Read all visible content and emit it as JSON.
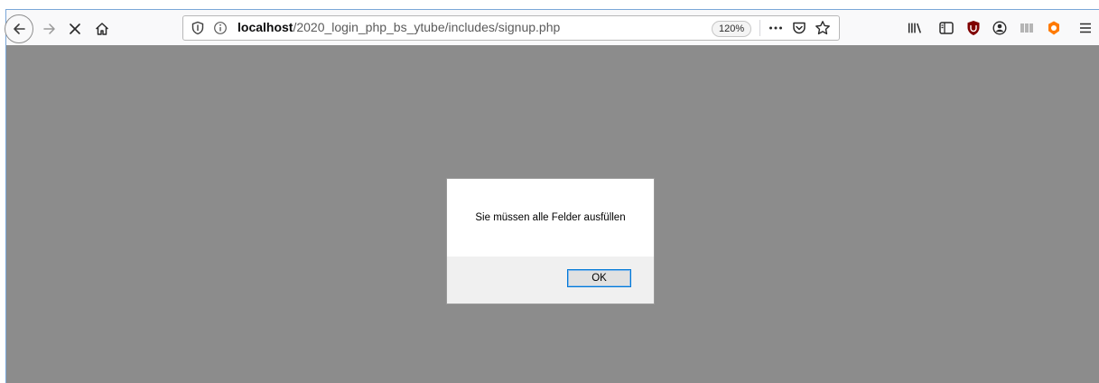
{
  "browser": {
    "url": {
      "host": "localhost",
      "path": "/2020_login_php_bs_ytube/includes/signup.php"
    },
    "zoom": "120%",
    "icons": {
      "nav": [
        "back-icon",
        "forward-icon",
        "stop-icon",
        "home-icon"
      ],
      "url": [
        "tracking-protection-shield-icon",
        "site-info-icon",
        "page-actions-menu-icon",
        "pocket-icon",
        "bookmark-star-icon"
      ],
      "toolbar": [
        "library-icon",
        "sidebar-icon",
        "ublock-origin-icon",
        "account-icon",
        "reader-view-icon",
        "extension-icon",
        "hamburger-menu-icon"
      ]
    },
    "colors": {
      "ublock": "#800000",
      "extension": "#ff7a00",
      "focus_border": "#7aa7d8"
    }
  },
  "page": {
    "background": "#8c8c8c"
  },
  "dialog": {
    "message": "Sie müssen alle Felder ausfüllen",
    "ok_label": "OK",
    "button_border": "#0078d7"
  }
}
